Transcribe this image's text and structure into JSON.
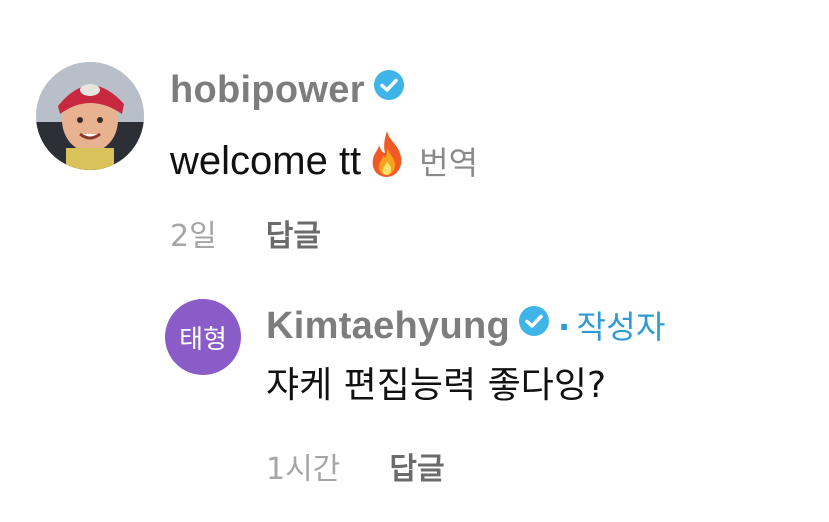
{
  "comment": {
    "username": "hobipower",
    "text": "welcome tt",
    "emoji_icon": "fire-emoji",
    "translate_label": "번역",
    "time": "2일",
    "reply_label": "답글"
  },
  "reply": {
    "avatar_text": "태형",
    "avatar_color": "#8a5cc8",
    "username": "Kimtaehyung",
    "separator": "·",
    "author_label": "작성자",
    "text": "쟈케 편집능력 좋다잉?",
    "time": "1시간",
    "reply_label": "답글"
  },
  "colors": {
    "verified": "#3fb4e8",
    "author_tag": "#2f9bd4"
  }
}
